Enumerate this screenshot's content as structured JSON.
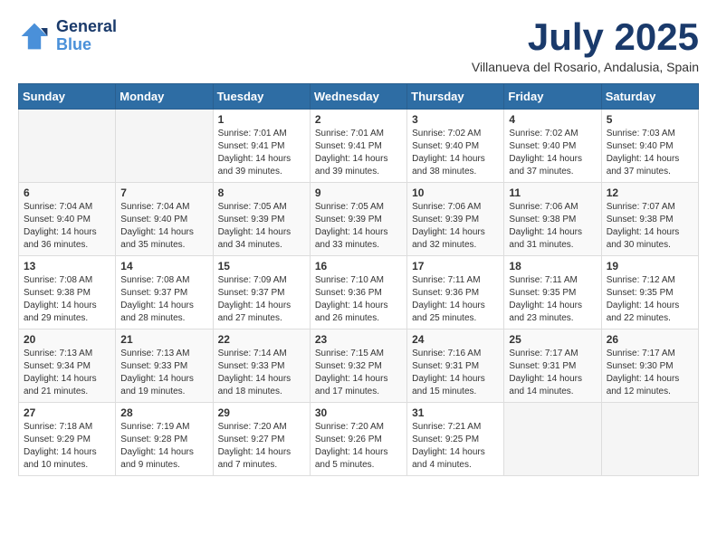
{
  "header": {
    "logo_line1": "General",
    "logo_line2": "Blue",
    "month_title": "July 2025",
    "subtitle": "Villanueva del Rosario, Andalusia, Spain"
  },
  "weekdays": [
    "Sunday",
    "Monday",
    "Tuesday",
    "Wednesday",
    "Thursday",
    "Friday",
    "Saturday"
  ],
  "weeks": [
    [
      {
        "day": "",
        "info": ""
      },
      {
        "day": "",
        "info": ""
      },
      {
        "day": "1",
        "info": "Sunrise: 7:01 AM\nSunset: 9:41 PM\nDaylight: 14 hours and 39 minutes."
      },
      {
        "day": "2",
        "info": "Sunrise: 7:01 AM\nSunset: 9:41 PM\nDaylight: 14 hours and 39 minutes."
      },
      {
        "day": "3",
        "info": "Sunrise: 7:02 AM\nSunset: 9:40 PM\nDaylight: 14 hours and 38 minutes."
      },
      {
        "day": "4",
        "info": "Sunrise: 7:02 AM\nSunset: 9:40 PM\nDaylight: 14 hours and 37 minutes."
      },
      {
        "day": "5",
        "info": "Sunrise: 7:03 AM\nSunset: 9:40 PM\nDaylight: 14 hours and 37 minutes."
      }
    ],
    [
      {
        "day": "6",
        "info": "Sunrise: 7:04 AM\nSunset: 9:40 PM\nDaylight: 14 hours and 36 minutes."
      },
      {
        "day": "7",
        "info": "Sunrise: 7:04 AM\nSunset: 9:40 PM\nDaylight: 14 hours and 35 minutes."
      },
      {
        "day": "8",
        "info": "Sunrise: 7:05 AM\nSunset: 9:39 PM\nDaylight: 14 hours and 34 minutes."
      },
      {
        "day": "9",
        "info": "Sunrise: 7:05 AM\nSunset: 9:39 PM\nDaylight: 14 hours and 33 minutes."
      },
      {
        "day": "10",
        "info": "Sunrise: 7:06 AM\nSunset: 9:39 PM\nDaylight: 14 hours and 32 minutes."
      },
      {
        "day": "11",
        "info": "Sunrise: 7:06 AM\nSunset: 9:38 PM\nDaylight: 14 hours and 31 minutes."
      },
      {
        "day": "12",
        "info": "Sunrise: 7:07 AM\nSunset: 9:38 PM\nDaylight: 14 hours and 30 minutes."
      }
    ],
    [
      {
        "day": "13",
        "info": "Sunrise: 7:08 AM\nSunset: 9:38 PM\nDaylight: 14 hours and 29 minutes."
      },
      {
        "day": "14",
        "info": "Sunrise: 7:08 AM\nSunset: 9:37 PM\nDaylight: 14 hours and 28 minutes."
      },
      {
        "day": "15",
        "info": "Sunrise: 7:09 AM\nSunset: 9:37 PM\nDaylight: 14 hours and 27 minutes."
      },
      {
        "day": "16",
        "info": "Sunrise: 7:10 AM\nSunset: 9:36 PM\nDaylight: 14 hours and 26 minutes."
      },
      {
        "day": "17",
        "info": "Sunrise: 7:11 AM\nSunset: 9:36 PM\nDaylight: 14 hours and 25 minutes."
      },
      {
        "day": "18",
        "info": "Sunrise: 7:11 AM\nSunset: 9:35 PM\nDaylight: 14 hours and 23 minutes."
      },
      {
        "day": "19",
        "info": "Sunrise: 7:12 AM\nSunset: 9:35 PM\nDaylight: 14 hours and 22 minutes."
      }
    ],
    [
      {
        "day": "20",
        "info": "Sunrise: 7:13 AM\nSunset: 9:34 PM\nDaylight: 14 hours and 21 minutes."
      },
      {
        "day": "21",
        "info": "Sunrise: 7:13 AM\nSunset: 9:33 PM\nDaylight: 14 hours and 19 minutes."
      },
      {
        "day": "22",
        "info": "Sunrise: 7:14 AM\nSunset: 9:33 PM\nDaylight: 14 hours and 18 minutes."
      },
      {
        "day": "23",
        "info": "Sunrise: 7:15 AM\nSunset: 9:32 PM\nDaylight: 14 hours and 17 minutes."
      },
      {
        "day": "24",
        "info": "Sunrise: 7:16 AM\nSunset: 9:31 PM\nDaylight: 14 hours and 15 minutes."
      },
      {
        "day": "25",
        "info": "Sunrise: 7:17 AM\nSunset: 9:31 PM\nDaylight: 14 hours and 14 minutes."
      },
      {
        "day": "26",
        "info": "Sunrise: 7:17 AM\nSunset: 9:30 PM\nDaylight: 14 hours and 12 minutes."
      }
    ],
    [
      {
        "day": "27",
        "info": "Sunrise: 7:18 AM\nSunset: 9:29 PM\nDaylight: 14 hours and 10 minutes."
      },
      {
        "day": "28",
        "info": "Sunrise: 7:19 AM\nSunset: 9:28 PM\nDaylight: 14 hours and 9 minutes."
      },
      {
        "day": "29",
        "info": "Sunrise: 7:20 AM\nSunset: 9:27 PM\nDaylight: 14 hours and 7 minutes."
      },
      {
        "day": "30",
        "info": "Sunrise: 7:20 AM\nSunset: 9:26 PM\nDaylight: 14 hours and 5 minutes."
      },
      {
        "day": "31",
        "info": "Sunrise: 7:21 AM\nSunset: 9:25 PM\nDaylight: 14 hours and 4 minutes."
      },
      {
        "day": "",
        "info": ""
      },
      {
        "day": "",
        "info": ""
      }
    ]
  ]
}
